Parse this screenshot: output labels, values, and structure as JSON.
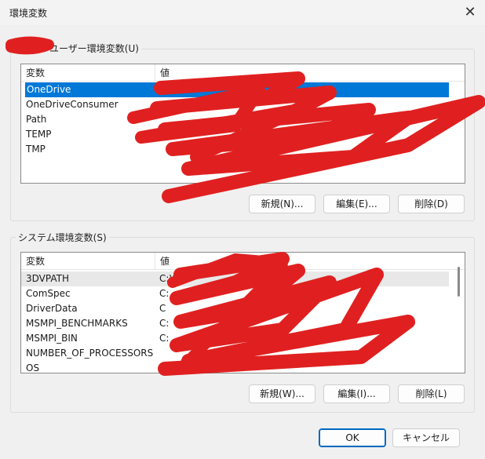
{
  "window": {
    "title": "環境変数",
    "close_glyph": "✕"
  },
  "user_section": {
    "label": "ユーザー環境変数(U)",
    "columns": [
      "変数",
      "値"
    ],
    "rows": [
      {
        "name": "OneDrive",
        "value": ""
      },
      {
        "name": "OneDriveConsumer",
        "value": ""
      },
      {
        "name": "Path",
        "value": ""
      },
      {
        "name": "TEMP",
        "value": ""
      },
      {
        "name": "TMP",
        "value": ""
      }
    ],
    "buttons": {
      "new": "新規(N)...",
      "edit": "編集(E)...",
      "delete": "削除(D)"
    }
  },
  "system_section": {
    "label": "システム環境変数(S)",
    "columns": [
      "変数",
      "値"
    ],
    "rows": [
      {
        "name": "3DVPATH",
        "value": "C:¥"
      },
      {
        "name": "ComSpec",
        "value": "C:"
      },
      {
        "name": "DriverData",
        "value": "C"
      },
      {
        "name": "MSMPI_BENCHMARKS",
        "value": "C:"
      },
      {
        "name": "MSMPI_BIN",
        "value": "C:"
      },
      {
        "name": "NUMBER_OF_PROCESSORS",
        "value": ""
      },
      {
        "name": "OS",
        "value": ""
      }
    ],
    "buttons": {
      "new": "新規(W)...",
      "edit": "編集(I)...",
      "delete": "削除(L)"
    }
  },
  "footer": {
    "ok": "OK",
    "cancel": "キャンセル"
  },
  "colors": {
    "selection": "#0078d7",
    "redaction": "#e02020",
    "default_button_border": "#0067c0"
  }
}
